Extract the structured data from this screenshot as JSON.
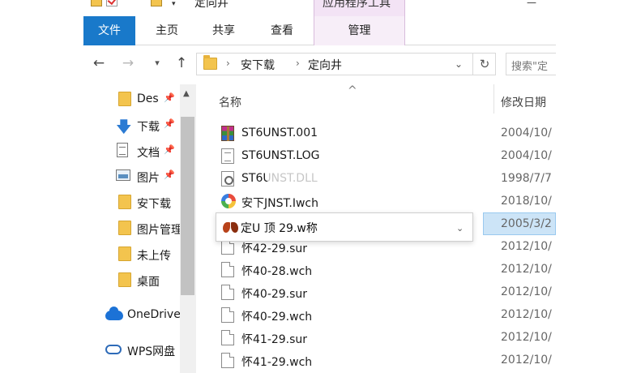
{
  "window": {
    "title": "定向井",
    "context_tab_group": "应用程序工具"
  },
  "ribbon": {
    "tabs": [
      {
        "label": "文件"
      },
      {
        "label": "主页"
      },
      {
        "label": "共享"
      },
      {
        "label": "查看"
      },
      {
        "label": "管理"
      }
    ]
  },
  "address_bar": {
    "breadcrumbs": [
      "安下载",
      "定向井"
    ],
    "search_placeholder": "搜索\"定"
  },
  "nav_pane": {
    "quick_access": [
      {
        "label": "Des",
        "icon": "folder-icon",
        "pinned": true
      },
      {
        "label": "下载",
        "icon": "download-arrow-icon",
        "pinned": true
      },
      {
        "label": "文档",
        "icon": "document-icon",
        "pinned": true
      },
      {
        "label": "图片",
        "icon": "picture-icon",
        "pinned": true
      },
      {
        "label": "安下载",
        "icon": "folder-icon",
        "pinned": false
      },
      {
        "label": "图片管理",
        "icon": "folder-icon",
        "pinned": false
      },
      {
        "label": "未上传",
        "icon": "folder-icon",
        "pinned": false
      },
      {
        "label": "桌面",
        "icon": "folder-icon",
        "pinned": false
      }
    ],
    "onedrive_label": "OneDrive",
    "wps_label": "WPS网盘"
  },
  "file_list": {
    "columns": {
      "name": "名称",
      "date": "修改日期"
    },
    "rows": [
      {
        "name": "ST6UNST.001",
        "date": "2004/10/",
        "icon": "archive-icon"
      },
      {
        "name": "ST6UNST.LOG",
        "date": "2004/10/",
        "icon": "log-file-icon"
      },
      {
        "name": "ST6UNST.DLL",
        "date": "1998/7/7",
        "icon": "gear-file-icon"
      },
      {
        "name": "安下JNST.Iwch",
        "date": "2018/10/",
        "icon": "wch-file-icon"
      },
      {
        "name": "",
        "date": "2005/3/2",
        "icon": "butterfly-app-icon",
        "selected": true
      },
      {
        "name": "怀42-29.sur",
        "date": "2012/10/",
        "icon": "file-icon"
      },
      {
        "name": "怀40-28.wch",
        "date": "2012/10/",
        "icon": "file-icon"
      },
      {
        "name": "怀40-29.sur",
        "date": "2012/10/",
        "icon": "file-icon"
      },
      {
        "name": "怀40-29.wch",
        "date": "2012/10/",
        "icon": "file-icon"
      },
      {
        "name": "怀41-29.sur",
        "date": "2012/10/",
        "icon": "file-icon"
      },
      {
        "name": "怀41-29.wch",
        "date": "2012/10/",
        "icon": "file-icon"
      }
    ]
  },
  "rename_popup": {
    "text": "定U 顶 29.w称"
  },
  "colors": {
    "file_tab": "#1979ca",
    "selection": "#cce4f7",
    "folder": "#f3c44e"
  }
}
